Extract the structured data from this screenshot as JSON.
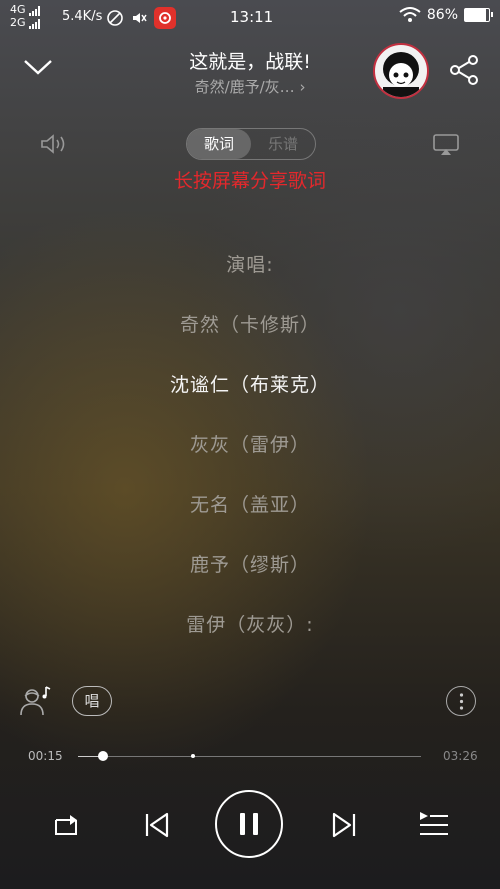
{
  "status_bar": {
    "net_top": "4G",
    "net_bottom": "2G",
    "speed": "5.4K/s",
    "time": "13:11",
    "battery": "86%",
    "battery_fraction": 0.86
  },
  "header": {
    "title": "这就是，战联!",
    "subtitle": "奇然/鹿予/灰… ›",
    "icons": [
      "chevron-down-icon",
      "avatar",
      "share-icon"
    ]
  },
  "tabs": [
    {
      "label": "歌词",
      "active": true
    },
    {
      "label": "乐谱",
      "active": false
    }
  ],
  "share_hint": "长按屏幕分享歌词",
  "lyrics": [
    {
      "text": "演唱:",
      "current": false
    },
    {
      "text": "奇然（卡修斯）",
      "current": false
    },
    {
      "text": "沈谧仁（布莱克）",
      "current": true
    },
    {
      "text": "灰灰（雷伊）",
      "current": false
    },
    {
      "text": "无名（盖亚）",
      "current": false
    },
    {
      "text": "鹿予（缪斯）",
      "current": false
    },
    {
      "text": "雷伊（灰灰）:",
      "current": false
    }
  ],
  "tools": {
    "sing_label": "唱"
  },
  "progress": {
    "current": "00:15",
    "total": "03:26",
    "played_fraction": 0.073,
    "buffered_fraction": 0.33
  },
  "controls": [
    "repeat-icon",
    "previous-icon",
    "pause-icon",
    "next-icon",
    "playlist-icon"
  ],
  "colors": {
    "accent_red": "#e3282c",
    "badge_red": "#e0312b"
  }
}
